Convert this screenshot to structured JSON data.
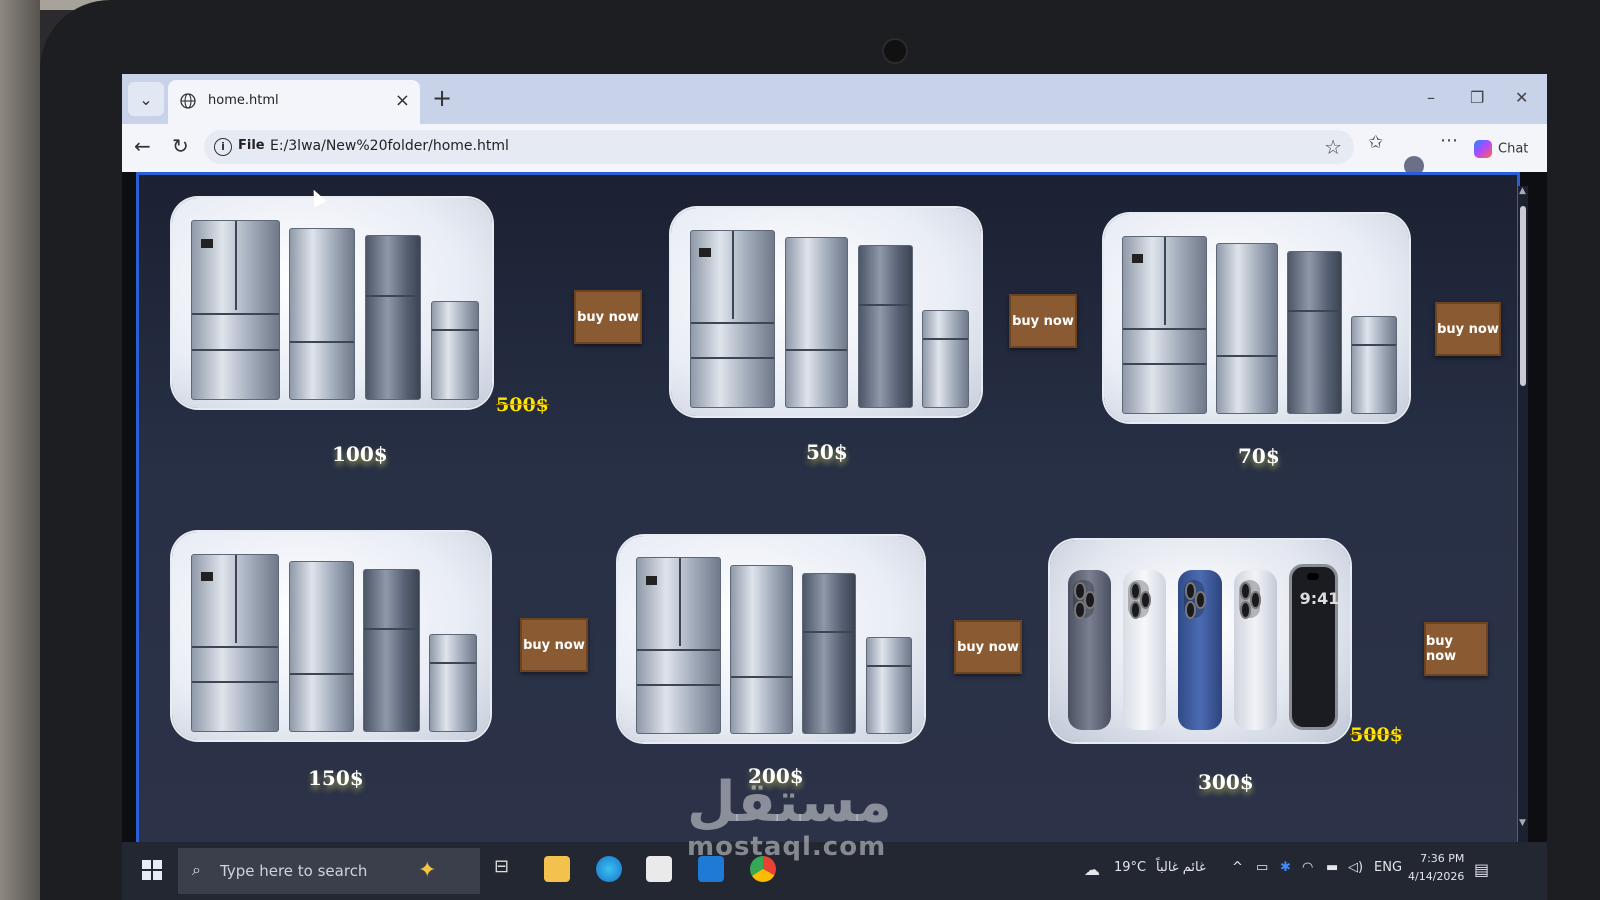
{
  "browser": {
    "tab_title": "home.html",
    "close_symbol": "×",
    "new_tab_symbol": "+",
    "address_scheme": "File",
    "address_path": "E:/3lwa/New%20folder/home.html",
    "chat_label": "Chat",
    "window_controls": [
      "–",
      "❐",
      "✕"
    ]
  },
  "products": [
    {
      "image": "fridge-set",
      "button_label": "buy now",
      "price": "100$",
      "old_price": "500$"
    },
    {
      "image": "fridge-set",
      "button_label": "buy now",
      "price": "50$",
      "old_price": ""
    },
    {
      "image": "fridge-set",
      "button_label": "buy now",
      "price": "70$",
      "old_price": ""
    },
    {
      "image": "fridge-set",
      "button_label": "buy now",
      "price": "150$",
      "old_price": ""
    },
    {
      "image": "fridge-set",
      "button_label": "buy now",
      "price": "200$",
      "old_price": ""
    },
    {
      "image": "iphone-set",
      "button_label": "buy now",
      "price": "300$",
      "old_price": "500$"
    }
  ],
  "phone_screen_time": "9:41",
  "taskbar": {
    "search_placeholder": "Type here to search",
    "weather_temp": "19°C",
    "weather_text": "غائم غالباً",
    "language": "ENG",
    "time": "7:36 PM",
    "date": "4/14/2026"
  },
  "watermark": {
    "arabic": "مستقل",
    "latin": "mostaql.com"
  },
  "colors": {
    "button_bg": "#8a5a32",
    "old_price": "#ffe600",
    "page_border": "#2b5fd6",
    "page_bg": "#283046"
  }
}
